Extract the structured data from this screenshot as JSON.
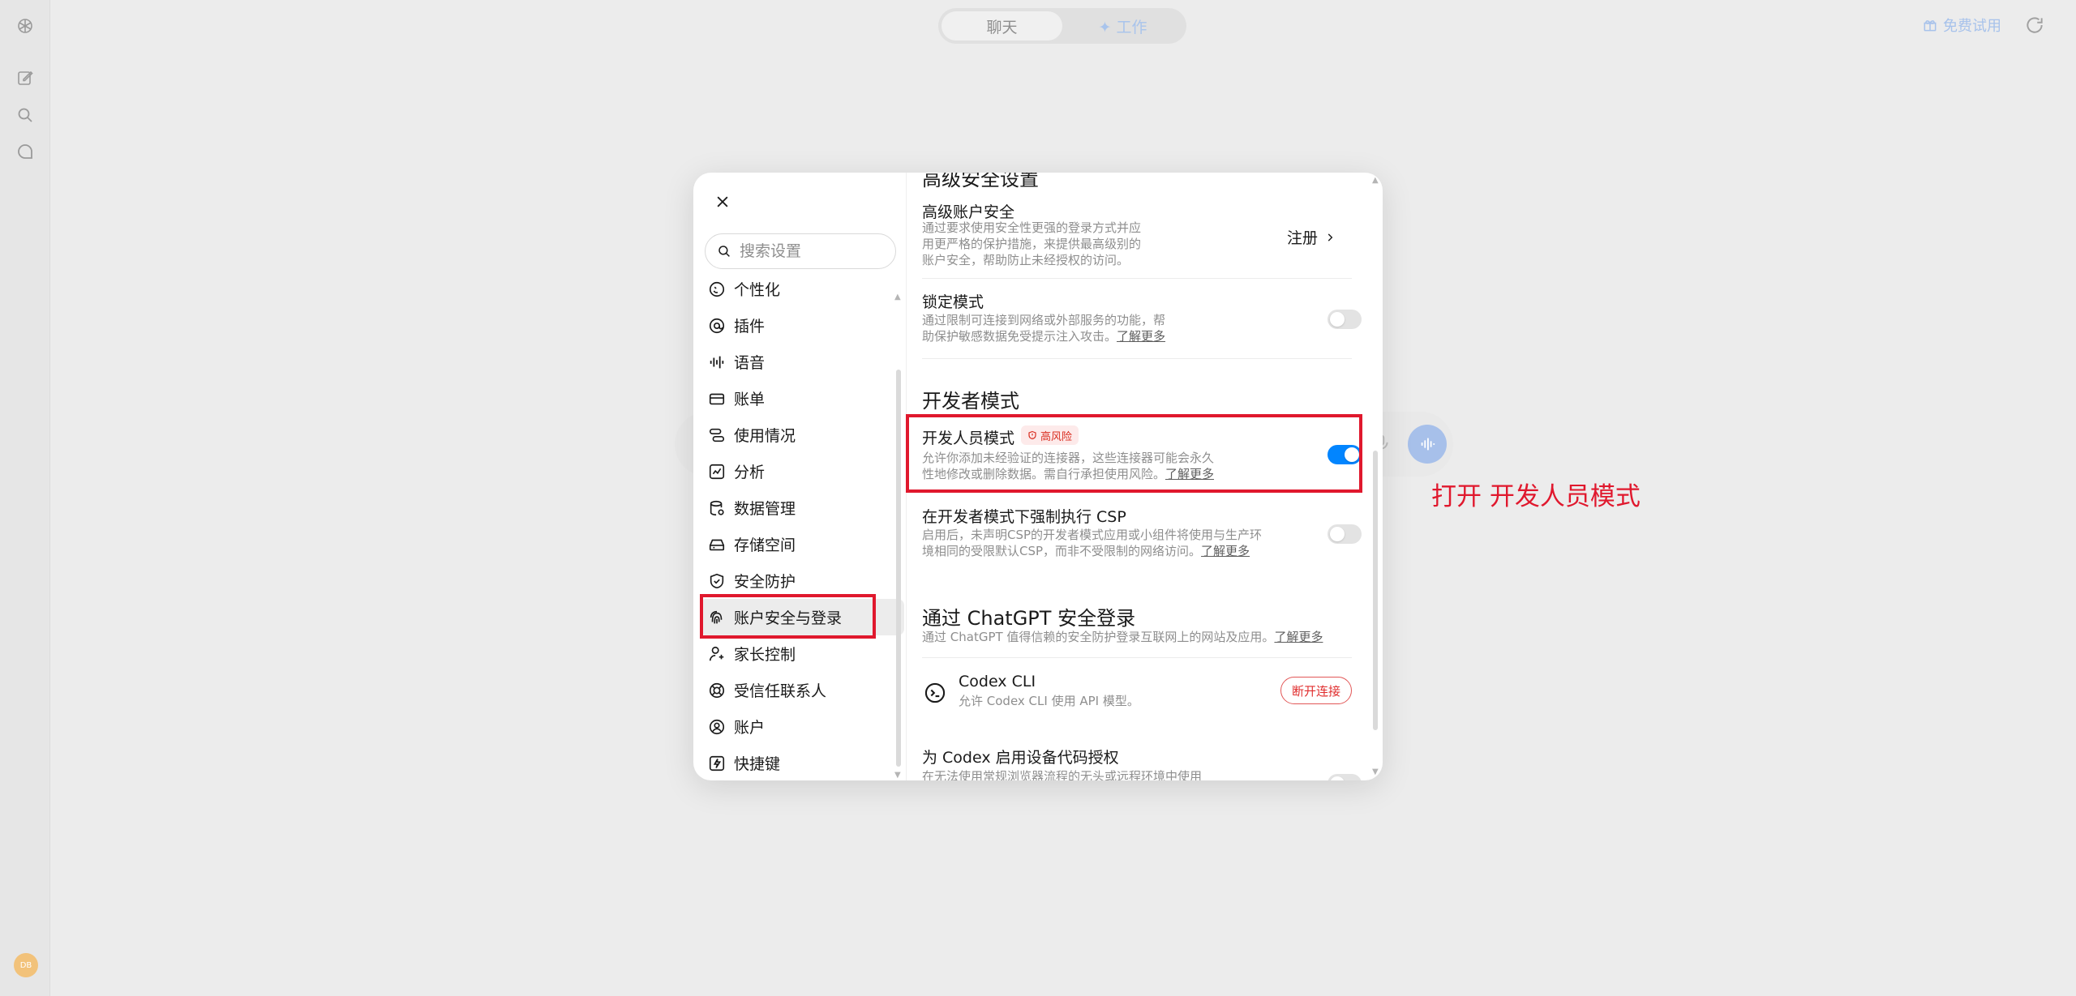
{
  "background": {
    "mode_switch": {
      "chat_label": "聊天",
      "work_label": "✦ 工作"
    },
    "trial_label": "免费试用",
    "avatar_initials": "DB"
  },
  "settings": {
    "search_placeholder": "搜索设置",
    "nav_items": [
      {
        "label": "个性化",
        "icon": "personalize-icon"
      },
      {
        "label": "插件",
        "icon": "plugin-icon"
      },
      {
        "label": "语音",
        "icon": "voice-icon"
      },
      {
        "label": "账单",
        "icon": "billing-card-icon"
      },
      {
        "label": "使用情况",
        "icon": "usage-icon"
      },
      {
        "label": "分析",
        "icon": "analytics-icon"
      },
      {
        "label": "数据管理",
        "icon": "data-icon"
      },
      {
        "label": "存储空间",
        "icon": "storage-icon"
      },
      {
        "label": "安全防护",
        "icon": "shield-icon"
      },
      {
        "label": "账户安全与登录",
        "icon": "fingerprint-icon"
      },
      {
        "label": "家长控制",
        "icon": "parent-icon"
      },
      {
        "label": "受信任联系人",
        "icon": "contacts-icon"
      },
      {
        "label": "账户",
        "icon": "account-icon"
      },
      {
        "label": "快捷键",
        "icon": "shortcut-icon"
      }
    ],
    "active_nav": "账户安全与登录",
    "content": {
      "advanced_security_heading": "高级安全设置",
      "advanced_account_security": {
        "title": "高级账户安全",
        "desc": [
          "通过要求使用安全性更强的登录方式并应",
          "用更严格的保护措施，来提供最高级别的",
          "账户安全，帮助防止未经授权的访问。"
        ],
        "action": "注册"
      },
      "lockdown": {
        "title": "锁定模式",
        "desc": [
          "通过限制可连接到网络或外部服务的功能，帮",
          "助保护敏感数据免受提示注入攻击。"
        ],
        "link": "了解更多",
        "enabled": false
      },
      "developer_heading": "开发者模式",
      "developer_mode": {
        "title": "开发人员模式",
        "badge": "高风险",
        "desc": [
          "允许你添加未经验证的连接器，这些连接器可能会永久",
          "性地修改或删除数据。需自行承担使用风险。"
        ],
        "link": "了解更多",
        "enabled": true
      },
      "csp": {
        "title": "在开发者模式下强制执行 CSP",
        "desc": [
          "启用后，未声明CSP的开发者模式应用或小组件将使用与生产环",
          "境相同的受限默认CSP，而非不受限制的网络访问。"
        ],
        "link": "了解更多",
        "enabled": false
      },
      "chatgpt_login_heading": "通过 ChatGPT 安全登录",
      "chatgpt_login_desc": "通过 ChatGPT 值得信赖的安全防护登录互联网上的网站及应用。",
      "chatgpt_login_link": "了解更多",
      "codex_cli": {
        "title": "Codex CLI",
        "desc": "允许 Codex CLI 使用 API 模型。",
        "action": "断开连接"
      },
      "codex_device_auth": {
        "title": "为 Codex 启用设备代码授权",
        "desc": "在无法使用常规浏览器流程的无头或远程环境中使用"
      }
    }
  },
  "annotation": {
    "label": "打开 开发人员模式",
    "color": "#e0182d"
  }
}
